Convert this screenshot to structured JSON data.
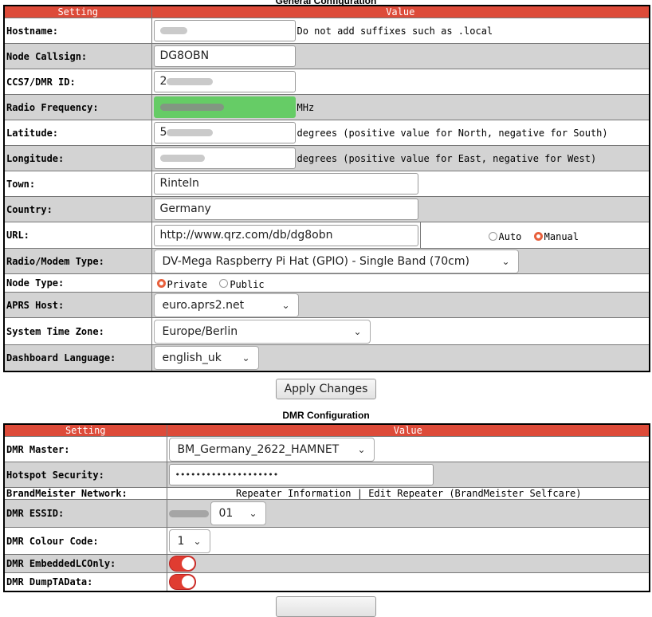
{
  "general": {
    "title": "General Configuration",
    "headers": {
      "setting": "Setting",
      "value": "Value"
    },
    "hostname": {
      "label": "Hostname:",
      "note": "Do not add suffixes such as .local"
    },
    "callsign": {
      "label": "Node Callsign:",
      "value": "DG8OBN"
    },
    "dmrid": {
      "label": "CCS7/DMR ID:",
      "prefix": "2"
    },
    "freq": {
      "label": "Radio Frequency:",
      "unit": "MHz",
      "highlight": "#66cc66"
    },
    "lat": {
      "label": "Latitude:",
      "prefix": "5",
      "note": "degrees (positive value for North, negative for South)"
    },
    "lon": {
      "label": "Longitude:",
      "note": "degrees (positive value for East, negative for West)"
    },
    "town": {
      "label": "Town:",
      "value": "Rinteln"
    },
    "country": {
      "label": "Country:",
      "value": "Germany"
    },
    "url": {
      "label": "URL:",
      "value": "http://www.qrz.com/db/dg8obn",
      "auto": "Auto",
      "manual": "Manual",
      "selected": "Manual"
    },
    "modem": {
      "label": "Radio/Modem Type:",
      "value": "DV-Mega Raspberry Pi Hat (GPIO) - Single Band (70cm)"
    },
    "nodetype": {
      "label": "Node Type:",
      "private": "Private",
      "public": "Public",
      "selected": "Private"
    },
    "aprs": {
      "label": "APRS Host:",
      "value": "euro.aprs2.net"
    },
    "timezone": {
      "label": "System Time Zone:",
      "value": "Europe/Berlin"
    },
    "language": {
      "label": "Dashboard Language:",
      "value": "english_uk"
    },
    "apply": "Apply Changes"
  },
  "dmr": {
    "title": "DMR Configuration",
    "headers": {
      "setting": "Setting",
      "value": "Value"
    },
    "master": {
      "label": "DMR Master:",
      "value": "BM_Germany_2622_HAMNET"
    },
    "security": {
      "label": "Hotspot Security:",
      "value": "••••••••••••••••••••"
    },
    "brandmeister": {
      "label": "BrandMeister Network:",
      "link1": "Repeater Information",
      "sep": "|",
      "link2": "Edit Repeater (BrandMeister Selfcare)"
    },
    "essid": {
      "label": "DMR ESSID:",
      "value": "01"
    },
    "colour": {
      "label": "DMR Colour Code:",
      "value": "1"
    },
    "embedded": {
      "label": "DMR EmbeddedLCOnly:",
      "state": "on"
    },
    "dumpta": {
      "label": "DMR DumpTAData:",
      "state": "on"
    }
  },
  "colors": {
    "header": "#dd4b39",
    "row_alt": "#d3d3d3",
    "toggle_on": "#e03c31",
    "radio_on": "#e8603c"
  },
  "icons": {
    "select": "chevron-down-icon"
  }
}
